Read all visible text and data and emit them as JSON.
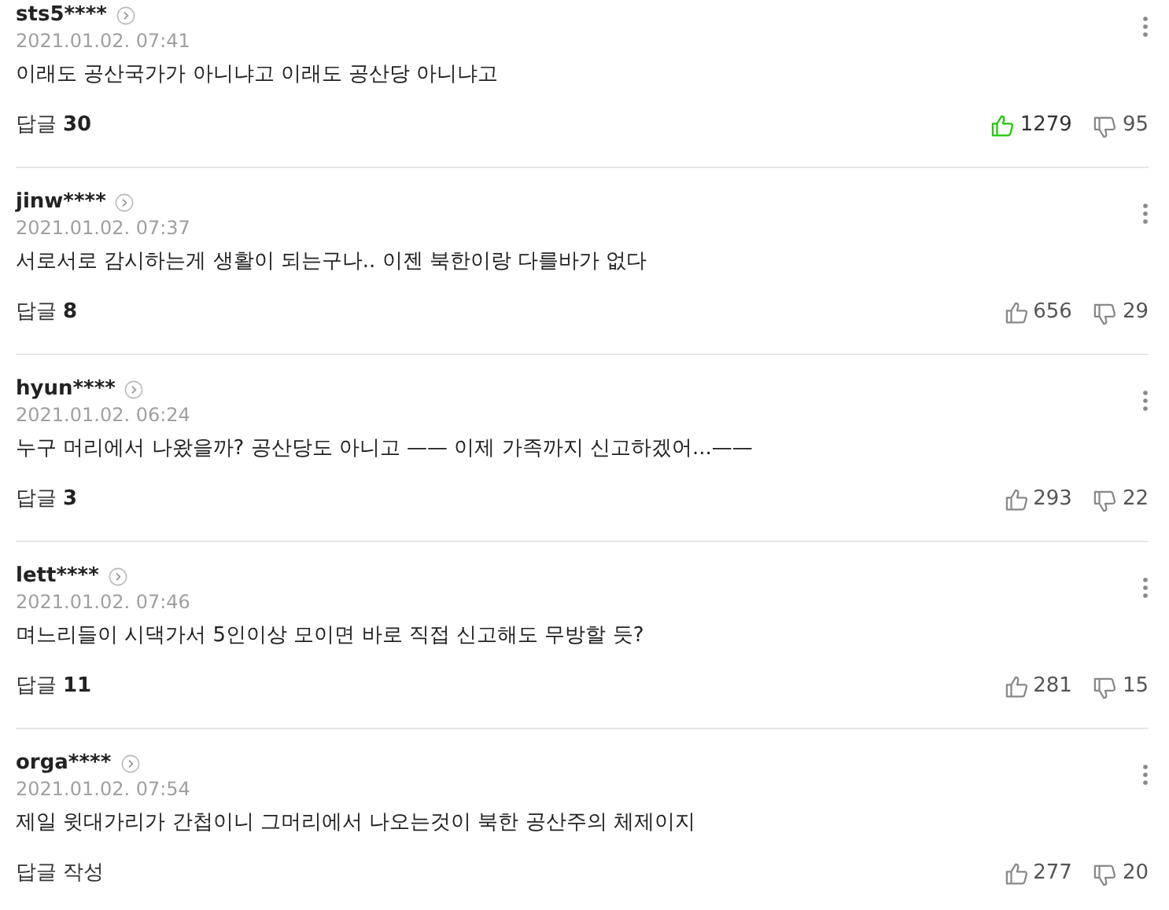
{
  "comments": [
    {
      "username": "sts5****",
      "date": "2021.01.02. 07:41",
      "text": "이래도 공산국가가 아니냐고 이래도 공산당 아니냐고",
      "reply_label": "답글",
      "reply_count": "30",
      "likes": "1279",
      "liked": true,
      "dislikes": "95"
    },
    {
      "username": "jinw****",
      "date": "2021.01.02. 07:37",
      "text": "서로서로 감시하는게 생활이 되는구나.. 이젠 북한이랑 다를바가 없다",
      "reply_label": "답글",
      "reply_count": "8",
      "likes": "656",
      "liked": false,
      "dislikes": "29"
    },
    {
      "username": "hyun****",
      "date": "2021.01.02. 06:24",
      "text": "누구 머리에서 나왔을까? 공산당도 아니고 —— 이제 가족까지 신고하겠어...——",
      "reply_label": "답글",
      "reply_count": "3",
      "likes": "293",
      "liked": false,
      "dislikes": "22"
    },
    {
      "username": "lett****",
      "date": "2021.01.02. 07:46",
      "text": "며느리들이 시댁가서 5인이상 모이면 바로 직접 신고해도 무방할 듯?",
      "reply_label": "답글",
      "reply_count": "11",
      "likes": "281",
      "liked": false,
      "dislikes": "15"
    },
    {
      "username": "orga****",
      "date": "2021.01.02. 07:54",
      "text": "제일 윗대가리가 간첩이니 그머리에서 나오는것이 북한 공산주의 체제이지",
      "reply_label": "답글 작성",
      "likes": "277",
      "liked": false,
      "dislikes": "20"
    }
  ]
}
